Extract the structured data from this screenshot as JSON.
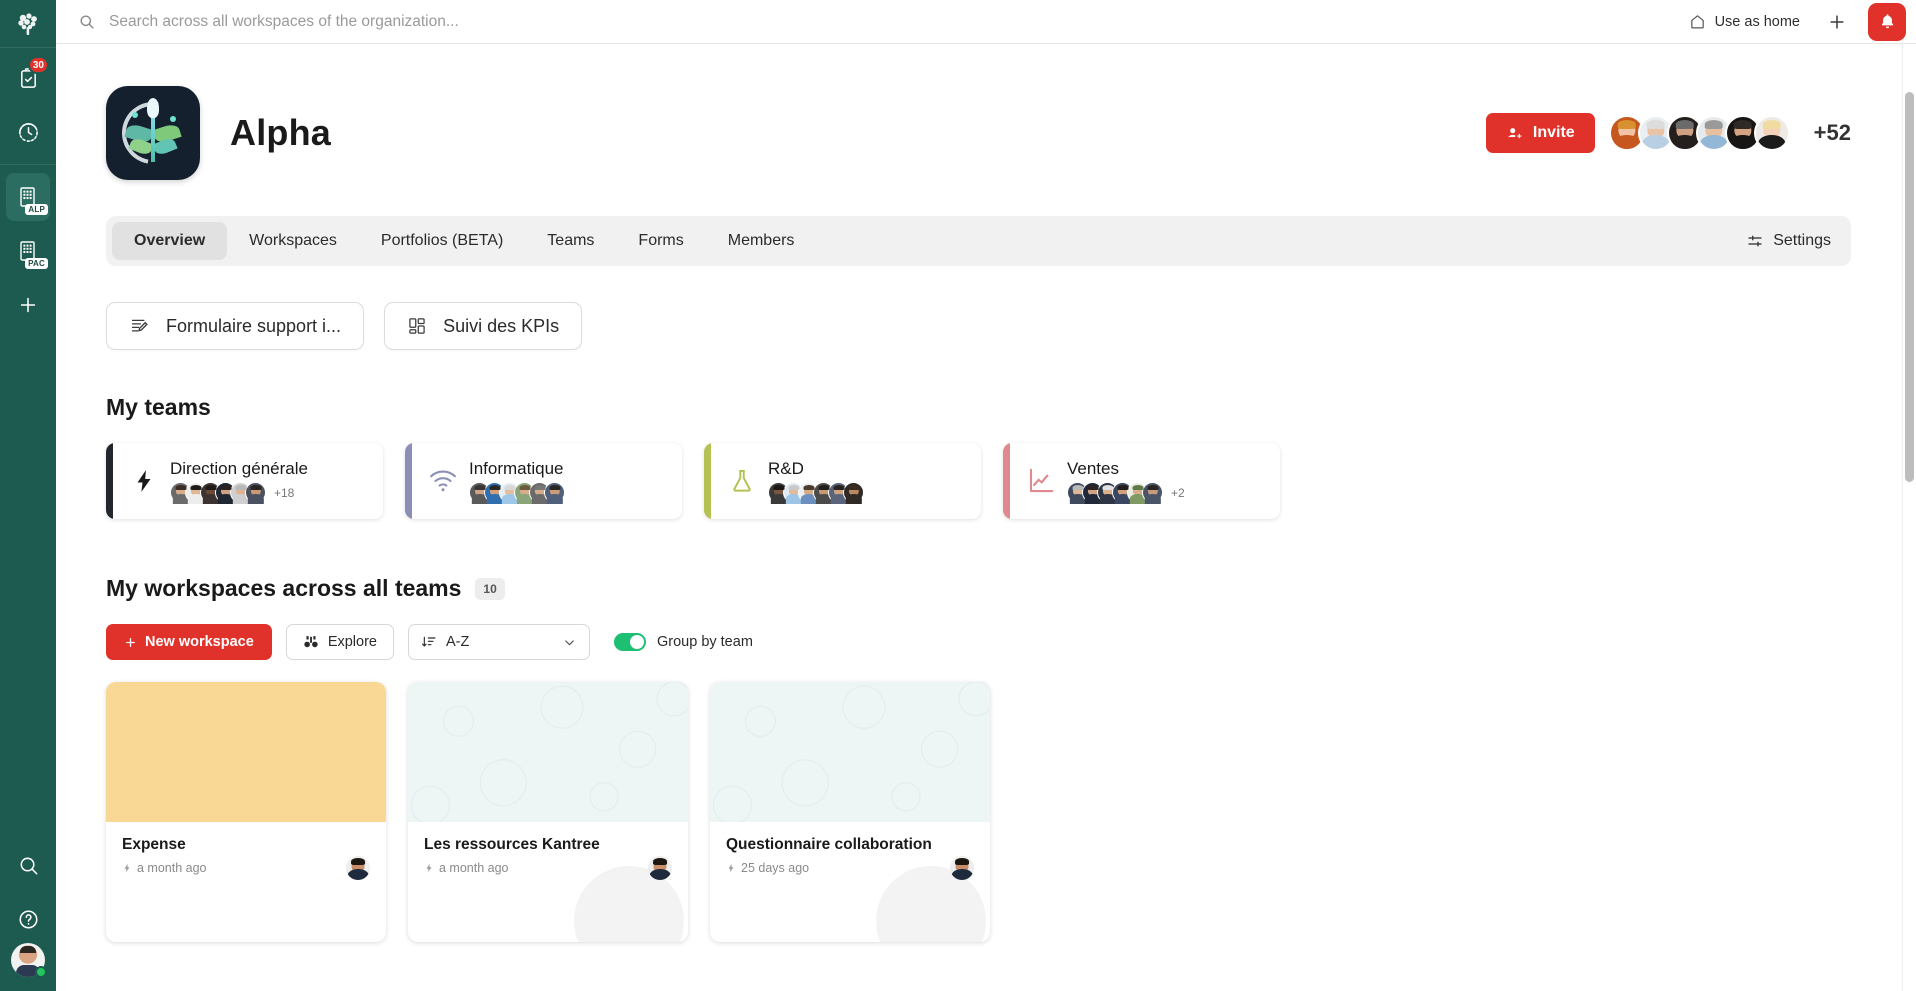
{
  "rail": {
    "logo_icon": "brain-tree-logo-icon",
    "items": [
      {
        "icon": "tasks-clipboard-icon",
        "badge": "30",
        "active": false,
        "name": "my-tasks"
      },
      {
        "icon": "clock-history-icon",
        "badge": "",
        "active": false,
        "name": "recent"
      },
      {
        "icon": "organization-building-icon",
        "tag": "ALP",
        "active": true,
        "name": "org-alpha"
      },
      {
        "icon": "organization-building-icon",
        "tag": "PAC",
        "active": false,
        "name": "org-pac"
      },
      {
        "icon": "plus-icon",
        "badge": "",
        "active": false,
        "name": "add-organization"
      }
    ],
    "bottom_items": [
      {
        "icon": "search-icon",
        "name": "global-search"
      },
      {
        "icon": "help-question-icon",
        "name": "help"
      }
    ],
    "avatar_name": "user-avatar",
    "presence": "online"
  },
  "topbar": {
    "search": {
      "placeholder": "Search across all workspaces of the organization...",
      "value": ""
    },
    "use_as_home_label": "Use as home",
    "use_as_home_icon": "home-icon",
    "plus_icon": "plus-icon",
    "bell_icon": "bell-icon",
    "bell_color": "#e0322b"
  },
  "org": {
    "title": "Alpha",
    "logo_icon": "alpha-org-logo",
    "invite_label": "Invite",
    "invite_icon": "person-add-icon",
    "invite_color": "#e0322b",
    "member_overflow": "+52",
    "member_avatars": [
      {
        "hair": "#d9912f",
        "skin": "#f0c3a4",
        "cloth": "#c6581f"
      },
      {
        "hair": "#dcdcdc",
        "skin": "#e8c3a6",
        "cloth": "#b9cfe3"
      },
      {
        "hair": "#6b6b6b",
        "skin": "#cfa183",
        "cloth": "#241f1d"
      },
      {
        "hair": "#9a9a9a",
        "skin": "#e7c0a0",
        "cloth": "#93b7d6"
      },
      {
        "hair": "#2f2a26",
        "skin": "#d6a382",
        "cloth": "#181614"
      },
      {
        "hair": "#f0dca0",
        "skin": "#f2d2b8",
        "cloth": "#1b1b1b"
      }
    ]
  },
  "tabs": {
    "items": [
      {
        "label": "Overview",
        "active": true
      },
      {
        "label": "Workspaces",
        "active": false
      },
      {
        "label": "Portfolios (BETA)",
        "active": false
      },
      {
        "label": "Teams",
        "active": false
      },
      {
        "label": "Forms",
        "active": false
      },
      {
        "label": "Members",
        "active": false
      }
    ],
    "settings_label": "Settings",
    "settings_icon": "sliders-icon"
  },
  "shortcuts": [
    {
      "label": "Formulaire support i...",
      "icon": "form-edit-icon"
    },
    {
      "label": "Suivi des KPIs",
      "icon": "dashboard-grid-icon"
    }
  ],
  "teams_section": {
    "title": "My teams",
    "cards": [
      {
        "name": "Direction générale",
        "icon": "lightning-bolt-icon",
        "color": "#22272e",
        "overflow": "+18",
        "avatars": [
          {
            "hair": "#3b2d25",
            "skin": "#d8ab8a",
            "cloth": "#6b6b6b"
          },
          {
            "hair": "#1f1b18",
            "skin": "#e2b794",
            "cloth": "#ededed"
          },
          {
            "hair": "#221a16",
            "skin": "#6b4a35",
            "cloth": "#3d3330"
          },
          {
            "hair": "#2a2320",
            "skin": "#d2a183",
            "cloth": "#1f2733"
          },
          {
            "hair": "#b8b8b8",
            "skin": "#dfb393",
            "cloth": "#cfcfcf"
          },
          {
            "hair": "#2b2420",
            "skin": "#c99a78",
            "cloth": "#4a5160"
          }
        ]
      },
      {
        "name": "Informatique",
        "icon": "wifi-icon",
        "color": "#8b8fb5",
        "overflow": "",
        "avatars": [
          {
            "hair": "#3a3330",
            "skin": "#cfa283",
            "cloth": "#5a5a5a"
          },
          {
            "hair": "#2d2723",
            "skin": "#d3a07e",
            "cloth": "#2f6fb0"
          },
          {
            "hair": "#d8d8d8",
            "skin": "#e5bd9c",
            "cloth": "#9fc7e8"
          },
          {
            "hair": "#6e5a3f",
            "skin": "#d7ac8a",
            "cloth": "#8aa57a"
          },
          {
            "hair": "#777777",
            "skin": "#d8ab88",
            "cloth": "#6b6b6b"
          },
          {
            "hair": "#2b2723",
            "skin": "#c99c7b",
            "cloth": "#50607a"
          }
        ]
      },
      {
        "name": "R&D",
        "icon": "flask-icon",
        "color": "#b5c153",
        "overflow": "",
        "avatars": [
          {
            "hair": "#1c1713",
            "skin": "#7a5540",
            "cloth": "#3a3a3a"
          },
          {
            "hair": "#c9c9c9",
            "skin": "#e3bb9a",
            "cloth": "#9ec4e6"
          },
          {
            "hair": "#4a3b2c",
            "skin": "#d9ab84",
            "cloth": "#6d8fbf"
          },
          {
            "hair": "#241e1a",
            "skin": "#c79a77",
            "cloth": "#4b4b4b"
          },
          {
            "hair": "#2a2420",
            "skin": "#cfa281",
            "cloth": "#59657a"
          },
          {
            "hair": "#3a2a20",
            "skin": "#b98763",
            "cloth": "#2f2a26"
          }
        ]
      },
      {
        "name": "Ventes",
        "icon": "line-chart-icon",
        "color": "#e08a90",
        "overflow": "+2",
        "avatars": [
          {
            "hair": "#b9b9b9",
            "skin": "#e0b694",
            "cloth": "#3e4a5e"
          },
          {
            "hair": "#2b2420",
            "skin": "#cfa382",
            "cloth": "#20283a"
          },
          {
            "hair": "#e2e2e2",
            "skin": "#dcb18d",
            "cloth": "#2e3545"
          },
          {
            "hair": "#241e1a",
            "skin": "#d2a07c",
            "cloth": "#3b4660"
          },
          {
            "hair": "#5f7a46",
            "skin": "#d9ad8b",
            "cloth": "#7f9a63"
          },
          {
            "hair": "#2a2420",
            "skin": "#c79b79",
            "cloth": "#4b5468"
          }
        ]
      }
    ]
  },
  "workspaces_section": {
    "title": "My workspaces across all teams",
    "count": "10",
    "toolbar": {
      "new_label": "New workspace",
      "new_icon": "plus-icon",
      "explore_label": "Explore",
      "explore_icon": "binoculars-icon",
      "sort_value": "A-Z",
      "sort_icon": "sort-descending-icon",
      "sort_chevron": "chevron-down-icon",
      "group_toggle_label": "Group by team",
      "group_toggle_on": true,
      "toggle_color": "#1dbf73"
    },
    "cards": [
      {
        "name": "Expense",
        "updated": "a month ago",
        "cover": "#f8d894",
        "cover_type": "solid",
        "meta_icon": "lightning-bolt-icon",
        "owner": "owner-avatar"
      },
      {
        "name": "Les ressources Kantree",
        "updated": "a month ago",
        "cover": "#eef5f5",
        "cover_type": "pattern",
        "meta_icon": "lightning-bolt-icon",
        "owner": "owner-avatar"
      },
      {
        "name": "Questionnaire collaboration",
        "updated": "25 days ago",
        "cover": "#eef5f5",
        "cover_type": "pattern",
        "meta_icon": "lightning-bolt-icon",
        "owner": "owner-avatar"
      }
    ]
  }
}
